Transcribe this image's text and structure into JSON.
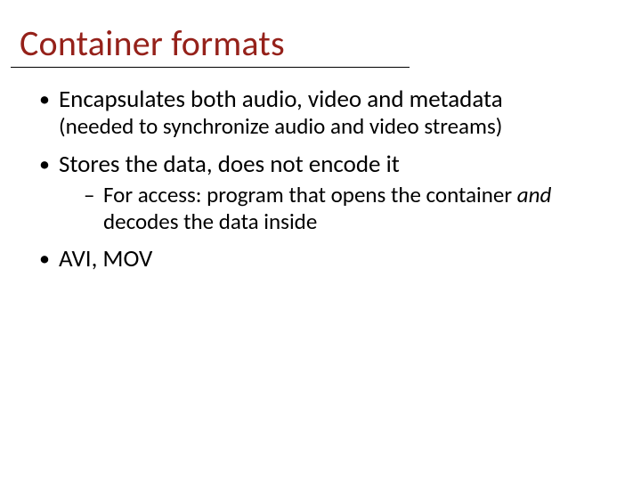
{
  "title": "Container formats",
  "bullets": [
    {
      "text": "Encapsulates both audio, video and metadata",
      "sub": "(needed to synchronize audio and video streams)"
    },
    {
      "text": "Stores the data, does not encode it",
      "children": [
        {
          "prefix": "For access: program that opens the container ",
          "italic": "and",
          "suffix": " decodes the data inside"
        }
      ]
    },
    {
      "text": "AVI, MOV"
    }
  ]
}
